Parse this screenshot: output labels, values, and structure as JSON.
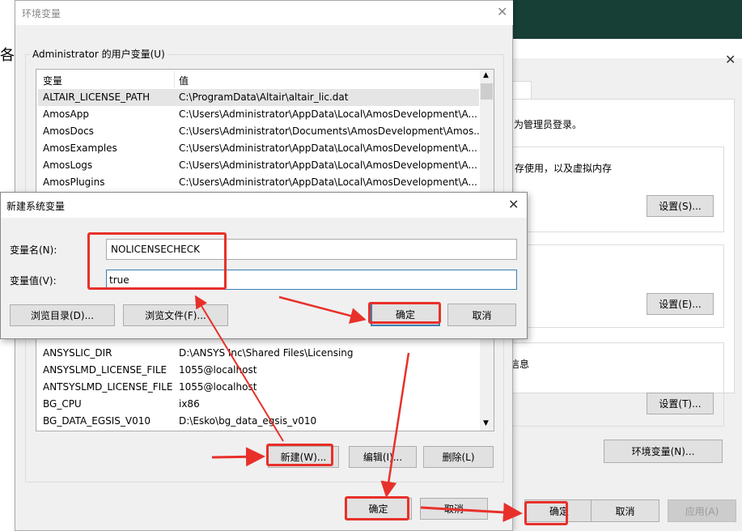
{
  "background": {
    "partial_text": "各",
    "accent_color": "#173f35"
  },
  "system_properties": {
    "tab_fragment": "程",
    "admin_note": "为管理员登录。",
    "perf_desc": "存使用，以及虚拟内存",
    "settings_s": "设置(S)...",
    "settings_e": "设置(E)...",
    "startup_fragment": "信息",
    "settings_t": "设置(T)...",
    "env_button": "环境变量(N)...",
    "ok": "确定",
    "cancel": "取消",
    "apply": "应用(A)"
  },
  "env_dialog": {
    "title": "环境变量",
    "group_label": "Administrator 的用户变量(U)",
    "columns": [
      "变量",
      "值"
    ],
    "rows_top": [
      {
        "name": "ALTAIR_LICENSE_PATH",
        "value": "C:\\ProgramData\\Altair\\altair_lic.dat"
      },
      {
        "name": "AmosApp",
        "value": "C:\\Users\\Administrator\\AppData\\Local\\AmosDevelopment\\A..."
      },
      {
        "name": "AmosDocs",
        "value": "C:\\Users\\Administrator\\Documents\\AmosDevelopment\\Amos..."
      },
      {
        "name": "AmosExamples",
        "value": "C:\\Users\\Administrator\\AppData\\Local\\AmosDevelopment\\A..."
      },
      {
        "name": "AmosLogs",
        "value": "C:\\Users\\Administrator\\AppData\\Local\\AmosDevelopment\\A..."
      },
      {
        "name": "AmosPlugins",
        "value": "C:\\Users\\Administrator\\AppData\\Local\\AmosDevelopment\\A..."
      }
    ],
    "rows_bottom": [
      {
        "name": "ANSYSLIC_DIR",
        "value": "D:\\ANSYS Inc\\Shared Files\\Licensing"
      },
      {
        "name": "ANSYSLMD_LICENSE_FILE",
        "value": "1055@localhost"
      },
      {
        "name": "ANTSYSLMD_LICENSE_FILE",
        "value": "1055@localhost"
      },
      {
        "name": "BG_CPU",
        "value": "ix86"
      },
      {
        "name": "BG_DATA_EGSIS_V010",
        "value": "D:\\Esko\\bg_data_egsis_v010"
      }
    ],
    "new": "新建(W)...",
    "edit": "编辑(I)...",
    "delete": "删除(L)",
    "ok": "确定",
    "cancel": "取消"
  },
  "new_var_dialog": {
    "title": "新建系统变量",
    "name_label": "变量名(N):",
    "name_value": "NOLICENSECHECK",
    "value_label": "变量值(V):",
    "value_value": "true",
    "browse_dir": "浏览目录(D)...",
    "browse_file": "浏览文件(F)...",
    "ok": "确定",
    "cancel": "取消"
  },
  "annotation_color": "#e8302a"
}
